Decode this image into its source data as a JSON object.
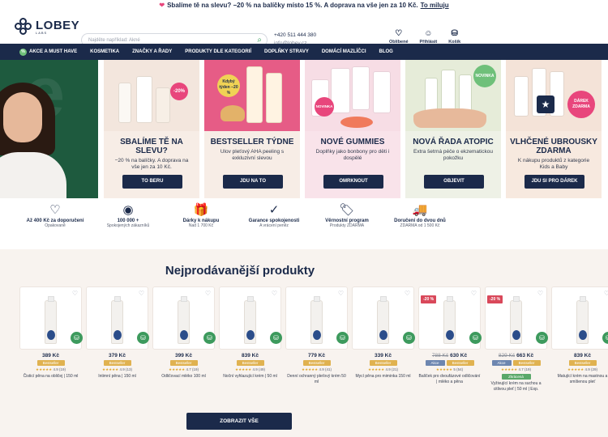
{
  "promo_bar": {
    "icon": "heart-icon",
    "text": "Sbalíme tě na slevu? −20 % na balíčky místo 15 %. A doprava na vše jen za 10 Kč.",
    "link": "To miluju"
  },
  "header": {
    "logo_text": "LOBEY",
    "logo_sub": "LABS",
    "search_placeholder": "Najděte například: Akné",
    "phone": "+420 511 444 380",
    "email": "info@lobey.cz",
    "icons": [
      {
        "name": "favorites-icon",
        "label": "Oblíbené"
      },
      {
        "name": "user-icon",
        "label": "Přihlásit"
      },
      {
        "name": "cart-icon",
        "label": "Košík"
      }
    ]
  },
  "nav": {
    "items": [
      "AKCE A MUST HAVE",
      "KOSMETIKA",
      "ZNAČKY A ŘADY",
      "PRODUKTY DLE KATEGORIÍ",
      "DOPLŇKY STRAVY",
      "DOMÁCÍ MAZLÍČCI",
      "BLOG"
    ],
    "badge": "%"
  },
  "hero_left_letter": "e",
  "banners": [
    {
      "title": "SBALÍME TĚ NA SLEVU?",
      "text": "−20 % na balíčky. A doprava na vše jen za 10 Kč.",
      "button": "TO BERU",
      "badge": "-20%",
      "bg": "#f3e6dd"
    },
    {
      "title": "BESTSELLER TÝDNE",
      "text": "Ulov pleťový AHA peeling s exkluzivní slevou",
      "button": "JDU NA TO",
      "badge": "Kdybý týden −20 %",
      "bg": "#e65c86"
    },
    {
      "title": "NOVÉ GUMMIES",
      "text": "Doplňky jako bonbony pro děti i dospělé",
      "button": "OMRKNOUT",
      "badge": "NOVINKA",
      "bg": "#f7dde5"
    },
    {
      "title": "NOVÁ ŘADA ATOPIC",
      "text": "Extra šetrná péče o ekzematickou pokožku",
      "button": "OBJEVIT",
      "badge": "NOVINKA",
      "bg": "#e6ecd9"
    },
    {
      "title": "VLHČENÉ UBROUSKY ZDARMA",
      "text": "K nákupu produktů z kategorie Kids a Baby",
      "button": "JDU SI PRO DÁREK",
      "badge": "DÁREK ZDARMA",
      "bg": "#f4e3d8"
    }
  ],
  "benefits": [
    {
      "icon": "heart-icon",
      "title": "Až 400 Kč za doporučení",
      "sub": "Opakovaně"
    },
    {
      "icon": "rating-seal-icon",
      "title": "100 000 +",
      "sub": "Spokojených zákazníků"
    },
    {
      "icon": "gift-icon",
      "title": "Dárky k nákupu",
      "sub": "Nad 1 700 Kč"
    },
    {
      "icon": "check-badge-icon",
      "title": "Garance spokojenosti",
      "sub": "A vrácení peněz"
    },
    {
      "icon": "tag-icon",
      "title": "Věrnostní program",
      "sub": "Produkty ZDARMA"
    },
    {
      "icon": "truck-icon",
      "title": "Doručení do dvou dnů",
      "sub": "ZDARMA od 1 500 Kč"
    }
  ],
  "bestsellers": {
    "title": "Nejprodávanější produkty",
    "button": "ZOBRAZIT VŠE",
    "bestseller_label": "Bestseller",
    "akce_label": "Akce",
    "products": [
      {
        "price": "389 Kč",
        "old": "",
        "rating": "4.9 (19)",
        "name": "Čisticí pěna na obličej | 150 ml",
        "discount": ""
      },
      {
        "price": "379 Kč",
        "old": "",
        "rating": "4.9 (13)",
        "name": "Intimní pěna | 150 ml",
        "discount": ""
      },
      {
        "price": "399 Kč",
        "old": "",
        "rating": "4.7 (19)",
        "name": "Odličovací mléko 100 ml",
        "discount": ""
      },
      {
        "price": "839 Kč",
        "old": "",
        "rating": "4.9 (49)",
        "name": "Noční vyhlazující krém | 50 ml",
        "discount": ""
      },
      {
        "price": "779 Kč",
        "old": "",
        "rating": "4.9 (41)",
        "name": "Denní ochranný pleťový krém 50 ml",
        "discount": ""
      },
      {
        "price": "339 Kč",
        "old": "",
        "rating": "4.9 (21)",
        "name": "Mycí pěna pro miminka 150 ml",
        "discount": ""
      },
      {
        "price": "630 Kč",
        "old": "788 Kč",
        "rating": "5 (54)",
        "name": "Balíček pro dvoufázové odličování | mléko a pěna",
        "discount": "-20 %"
      },
      {
        "price": "663 Kč",
        "old": "829 Kč",
        "rating": "4.7 (19)",
        "name": "Vyživující krém na suchou a citlivou pleť | 50 ml | Exp.",
        "discount": "-20 %",
        "extra": "Zkrácená expirace"
      },
      {
        "price": "839 Kč",
        "old": "",
        "rating": "4.9 (29)",
        "name": "Matující krém na mastnou a smíšenou pleť",
        "discount": ""
      }
    ]
  }
}
